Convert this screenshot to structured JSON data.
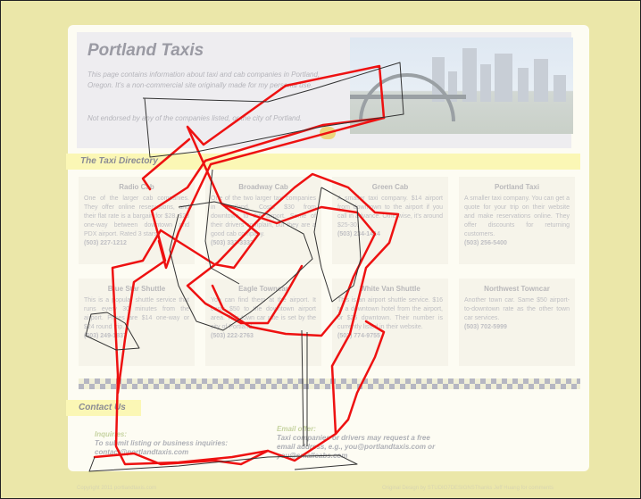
{
  "header": {
    "title": "Portland Taxis",
    "intro": "This page contains information about taxi and cab companies in Portland, Oregon. It's a non-commercial site originally made for my personal use.",
    "disclaimer": "Not endorsed by any of the companies listed, or the city of Portland."
  },
  "directory": {
    "heading": "The Taxi Directory",
    "cards": [
      {
        "name": "Radio Cab",
        "desc": "One of the larger cab companies. They offer online reservations, and their flat rate is a bargain for $28. $28 one-way between downtown and PDX airport. Rated 3 stars.",
        "phone": "(503) 227-1212"
      },
      {
        "name": "Broadway Cab",
        "desc": "One of the two larger taxi companies in Portland. Costs $30 from downtown to the airport. Some of their drivers complain, but they are a good cab company.",
        "phone": "(503) 333-3333"
      },
      {
        "name": "Green Cab",
        "desc": "A smaller taxi company. $14 airport from downtown to the airport if you call in advance. Otherwise, it's around $25-30.",
        "phone": "(503) 234-1414"
      },
      {
        "name": "Portland Taxi",
        "desc": "A smaller taxi company. You can get a quote for your trip on their website and make reservations online. They offer discounts for returning customers.",
        "phone": "(503) 256-5400"
      },
      {
        "name": "Blue Star Shuttle",
        "desc": "This is a popular shuttle service that runs every 30 minutes from the airport. Prices are $14 one-way or $24 round trip.",
        "phone": "(503) 249-1837"
      },
      {
        "name": "Eagle Towncar",
        "desc": "You can find them at the airport. It costs $50 to the downtown airport area. This town car rate is set by the city of Portland.",
        "phone": "(503) 222-2763"
      },
      {
        "name": "White Van Shuttle",
        "desc": "This is an airport shuttle service. $16 to a downtown hotel from the airport, or $25 downtown. Their number is currently listed in their website.",
        "phone": "(503) 774-9755"
      },
      {
        "name": "Northwest Towncar",
        "desc": "Another town car. Same $50 airport-to-downtown rate as the other town car services.",
        "phone": "(503) 702-5999"
      }
    ]
  },
  "contact": {
    "heading": "Contact Us",
    "inquiries_title": "Inquiries:",
    "inquiries_body": "To submit listing or business inquiries: contact@portlandtaxis.com",
    "email_title": "Email offer:",
    "email_body": "Taxi companies or drivers may request a free email address, e.g., you@portlandtaxis.com or you@smallcabs.com"
  },
  "footer": {
    "left": "Copyright 2011 portlandtaxis.com",
    "right": "Original Design by STUDIO7DESIGNSThanks Jeff Huang for comments"
  },
  "colors": {
    "background": "#ebe7a9",
    "scribble_red": "#ee1111",
    "scribble_dark": "#333333",
    "highlight_bar": "#fbf7b5"
  }
}
